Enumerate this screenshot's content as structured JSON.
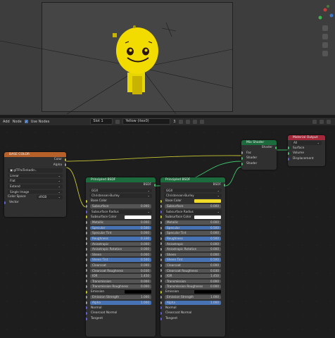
{
  "header": {
    "menu_add": "Add",
    "menu_node": "Node",
    "use_nodes_label": "Use Nodes",
    "slot_value": "Slot 1",
    "material_name": "Yellow (itex0)",
    "material_users": "3"
  },
  "nodes": {
    "image_texture": {
      "title": "BASE COLOR",
      "output_color": "Color",
      "output_alpha": "Alpha",
      "image_name": "glTFtoTerkadin..",
      "interpolation": "Linear",
      "projection": "Flat",
      "extension": "Extend",
      "source": "Single Image",
      "color_space_label": "Color Space",
      "color_space_value": "sRGB",
      "input_vector": "Vector"
    },
    "bsdf1": {
      "title": "Principled BSDF",
      "output": "BSDF",
      "distribution": "GGX",
      "subsurface_method": "Christensen-Burley",
      "base_color": "Base Color",
      "rows": [
        {
          "label": "Subsurface",
          "value": "0.000",
          "type": "field"
        },
        {
          "label": "Subsurface Radius",
          "value": "",
          "type": "drop"
        },
        {
          "label": "Subsurface Color",
          "value": "",
          "type": "swatch",
          "color": "#ffffff"
        },
        {
          "label": "Metallic",
          "value": "0.000",
          "type": "field"
        },
        {
          "label": "Specular",
          "value": "0.500",
          "type": "blue"
        },
        {
          "label": "Specular Tint",
          "value": "0.000",
          "type": "field"
        },
        {
          "label": "Roughness",
          "value": "0.330",
          "type": "blue"
        },
        {
          "label": "Anisotropic",
          "value": "0.000",
          "type": "field"
        },
        {
          "label": "Anisotropic Rotation",
          "value": "0.000",
          "type": "field"
        },
        {
          "label": "Sheen",
          "value": "0.000",
          "type": "field"
        },
        {
          "label": "Sheen Tint",
          "value": "0.500",
          "type": "blue"
        },
        {
          "label": "Clearcoat",
          "value": "0.000",
          "type": "field"
        },
        {
          "label": "Clearcoat Roughness",
          "value": "0.030",
          "type": "field"
        },
        {
          "label": "IOR",
          "value": "1.450",
          "type": "field"
        },
        {
          "label": "Transmission",
          "value": "0.000",
          "type": "field"
        },
        {
          "label": "Transmission Roughness",
          "value": "0.000",
          "type": "field"
        },
        {
          "label": "Emission",
          "value": "",
          "type": "swatch",
          "color": "#000000"
        },
        {
          "label": "Emission Strength",
          "value": "1.000",
          "type": "field"
        },
        {
          "label": "Alpha",
          "value": "1.000",
          "type": "blue"
        },
        {
          "label": "Normal",
          "value": "",
          "type": "plain"
        },
        {
          "label": "Clearcoat Normal",
          "value": "",
          "type": "plain"
        },
        {
          "label": "Tangent",
          "value": "",
          "type": "plain"
        }
      ]
    },
    "bsdf2": {
      "title": "Principled BSDF",
      "output": "BSDF",
      "distribution": "GGX",
      "subsurface_method": "Christensen-Burley",
      "base_color": "Base Color",
      "base_color_swatch": "#f0dc28",
      "rows": [
        {
          "label": "Subsurface",
          "value": "0.000",
          "type": "field"
        },
        {
          "label": "Subsurface Radius",
          "value": "",
          "type": "drop"
        },
        {
          "label": "Subsurface Color",
          "value": "",
          "type": "swatch",
          "color": "#ffffff"
        },
        {
          "label": "Metallic",
          "value": "0.000",
          "type": "field"
        },
        {
          "label": "Specular",
          "value": "0.500",
          "type": "blue"
        },
        {
          "label": "Specular Tint",
          "value": "0.000",
          "type": "field"
        },
        {
          "label": "Roughness",
          "value": "0.500",
          "type": "blue"
        },
        {
          "label": "Anisotropic",
          "value": "0.000",
          "type": "field"
        },
        {
          "label": "Anisotropic Rotation",
          "value": "0.000",
          "type": "field"
        },
        {
          "label": "Sheen",
          "value": "0.000",
          "type": "field"
        },
        {
          "label": "Sheen Tint",
          "value": "0.500",
          "type": "blue"
        },
        {
          "label": "Clearcoat",
          "value": "0.000",
          "type": "field"
        },
        {
          "label": "Clearcoat Roughness",
          "value": "0.030",
          "type": "field"
        },
        {
          "label": "IOR",
          "value": "1.450",
          "type": "field"
        },
        {
          "label": "Transmission",
          "value": "0.000",
          "type": "field"
        },
        {
          "label": "Transmission Roughness",
          "value": "0.000",
          "type": "field"
        },
        {
          "label": "Emission",
          "value": "",
          "type": "swatch",
          "color": "#000000"
        },
        {
          "label": "Emission Strength",
          "value": "1.000",
          "type": "field"
        },
        {
          "label": "Alpha",
          "value": "1.000",
          "type": "blue"
        },
        {
          "label": "Normal",
          "value": "",
          "type": "plain"
        },
        {
          "label": "Clearcoat Normal",
          "value": "",
          "type": "plain"
        },
        {
          "label": "Tangent",
          "value": "",
          "type": "plain"
        }
      ]
    },
    "mix_shader": {
      "title": "Mix Shader",
      "output": "Shader",
      "input_fac": "Fac",
      "input_shader1": "Shader",
      "input_shader2": "Shader"
    },
    "material_output": {
      "title": "Material Output",
      "target": "All",
      "input_surface": "Surface",
      "input_volume": "Volume",
      "input_displacement": "Displacement"
    }
  },
  "colors": {
    "shader_header": "#1b6b3c",
    "texture_header": "#b6602a",
    "output_header": "#a5283a",
    "character_yellow": "#e8d600"
  }
}
